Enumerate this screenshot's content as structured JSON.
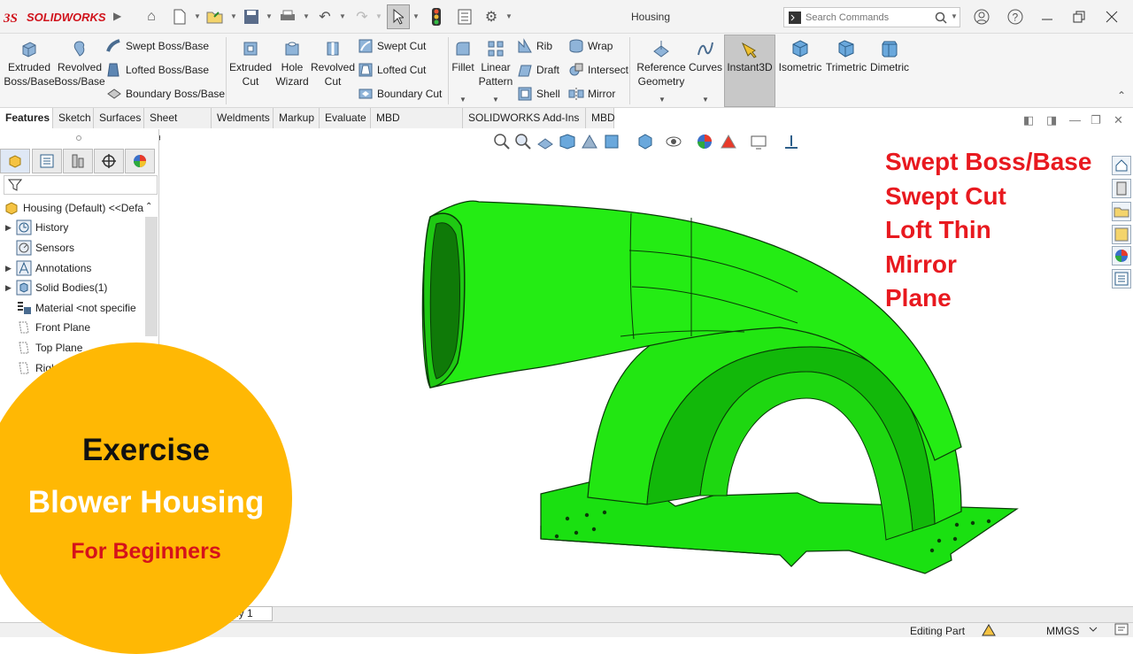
{
  "app": {
    "logo_text": "SOLIDWORKS",
    "document_title": "Housing",
    "brand_color": "#d0121b"
  },
  "search": {
    "placeholder": "Search Commands"
  },
  "ribbon": {
    "extruded_boss": "Extruded Boss/Base",
    "revolved_boss": "Revolved Boss/Base",
    "swept_boss": "Swept Boss/Base",
    "lofted_boss": "Lofted Boss/Base",
    "boundary_boss": "Boundary Boss/Base",
    "extruded_cut": "Extruded Cut",
    "hole_wizard": "Hole Wizard",
    "revolved_cut": "Revolved Cut",
    "swept_cut": "Swept Cut",
    "lofted_cut": "Lofted Cut",
    "boundary_cut": "Boundary Cut",
    "fillet": "Fillet",
    "linear_pattern": "Linear Pattern",
    "rib": "Rib",
    "draft": "Draft",
    "shell": "Shell",
    "wrap": "Wrap",
    "intersect": "Intersect",
    "mirror": "Mirror",
    "reference_geometry": "Reference Geometry",
    "curves": "Curves",
    "instant3d": "Instant3D",
    "isometric": "Isometric",
    "trimetric": "Trimetric",
    "dimetric": "Dimetric"
  },
  "tabs": [
    {
      "label": "Features",
      "active": true
    },
    {
      "label": "Sketch"
    },
    {
      "label": "Surfaces"
    },
    {
      "label": "Sheet Metal"
    },
    {
      "label": "Weldments"
    },
    {
      "label": "Markup"
    },
    {
      "label": "Evaluate"
    },
    {
      "label": "MBD Dimensions"
    },
    {
      "label": "SOLIDWORKS Add-Ins"
    },
    {
      "label": "MBD"
    }
  ],
  "tree": {
    "root": "Housing (Default) <<Defa",
    "items": [
      {
        "label": "History"
      },
      {
        "label": "Sensors"
      },
      {
        "label": "Annotations"
      },
      {
        "label": "Solid Bodies(1)"
      },
      {
        "label": "Material <not specifie"
      },
      {
        "label": "Front Plane"
      },
      {
        "label": "Top Plane"
      },
      {
        "label": "Right"
      }
    ]
  },
  "callouts": [
    "Swept Boss/Base",
    "Swept Cut",
    "Loft Thin",
    "Mirror",
    "Plane"
  ],
  "badge": {
    "title": "Exercise",
    "subtitle": "Blower Housing",
    "level": "For Beginners"
  },
  "bottom": {
    "study_tab": "Study 1"
  },
  "status": {
    "editing": "Editing Part",
    "units": "MMGS"
  },
  "colors": {
    "model": "#22ee11",
    "callout": "#e8191f",
    "badge": "#ffb804"
  }
}
